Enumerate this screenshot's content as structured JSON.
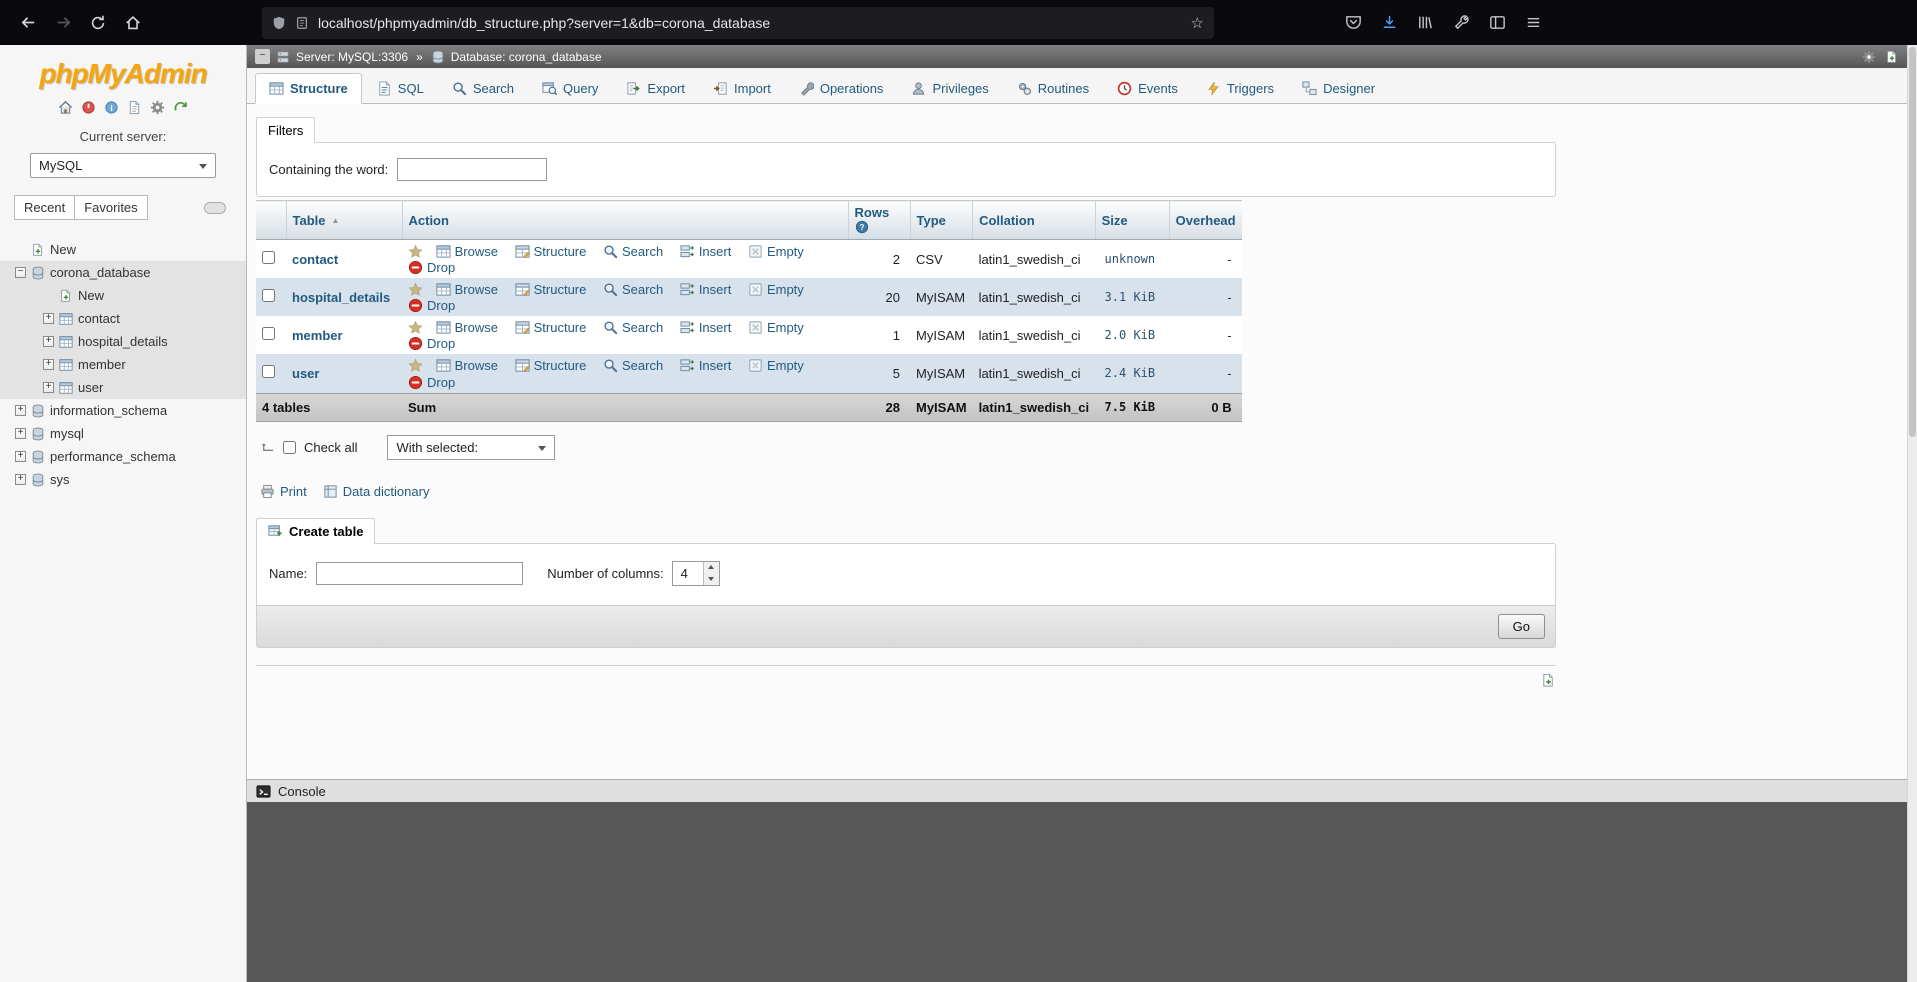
{
  "browser": {
    "url": "localhost/phpmyadmin/db_structure.php?server=1&db=corona_database"
  },
  "sidebar": {
    "logo": "phpMyAdmin",
    "current_server_label": "Current server:",
    "server_select": "MySQL",
    "recent_label": "Recent",
    "favorites_label": "Favorites",
    "tree": {
      "new_top": "New",
      "database": "corona_database",
      "new_sub": "New",
      "tables": [
        "contact",
        "hospital_details",
        "member",
        "user"
      ],
      "others": [
        "information_schema",
        "mysql",
        "performance_schema",
        "sys"
      ]
    }
  },
  "serverbar": {
    "server": "Server: MySQL:3306",
    "sep": "»",
    "database": "Database: corona_database"
  },
  "tabs": [
    {
      "label": "Structure",
      "icon": "structure-table-icon"
    },
    {
      "label": "SQL",
      "icon": "sql-file-icon"
    },
    {
      "label": "Search",
      "icon": "search-icon"
    },
    {
      "label": "Query",
      "icon": "query-icon"
    },
    {
      "label": "Export",
      "icon": "export-icon"
    },
    {
      "label": "Import",
      "icon": "import-icon"
    },
    {
      "label": "Operations",
      "icon": "operations-wrench-icon"
    },
    {
      "label": "Privileges",
      "icon": "privileges-user-icon"
    },
    {
      "label": "Routines",
      "icon": "routines-gears-icon"
    },
    {
      "label": "Events",
      "icon": "events-clock-icon"
    },
    {
      "label": "Triggers",
      "icon": "triggers-bolt-icon"
    },
    {
      "label": "Designer",
      "icon": "designer-icon"
    }
  ],
  "filters": {
    "legend": "Filters",
    "containing_label": "Containing the word:"
  },
  "tables_list": {
    "headers": {
      "table": "Table",
      "action": "Action",
      "rows": "Rows",
      "type": "Type",
      "collation": "Collation",
      "size": "Size",
      "overhead": "Overhead"
    },
    "actions": {
      "browse": "Browse",
      "structure": "Structure",
      "search": "Search",
      "insert": "Insert",
      "empty": "Empty",
      "drop": "Drop"
    },
    "rows": [
      {
        "name": "contact",
        "rows": "2",
        "type": "CSV",
        "collation": "latin1_swedish_ci",
        "size": "unknown",
        "overhead": "-"
      },
      {
        "name": "hospital_details",
        "rows": "20",
        "type": "MyISAM",
        "collation": "latin1_swedish_ci",
        "size": "3.1 KiB",
        "overhead": "-"
      },
      {
        "name": "member",
        "rows": "1",
        "type": "MyISAM",
        "collation": "latin1_swedish_ci",
        "size": "2.0 KiB",
        "overhead": "-"
      },
      {
        "name": "user",
        "rows": "5",
        "type": "MyISAM",
        "collation": "latin1_swedish_ci",
        "size": "2.4 KiB",
        "overhead": "-"
      }
    ],
    "sum": {
      "count": "4 tables",
      "label": "Sum",
      "rows": "28",
      "type": "MyISAM",
      "collation": "latin1_swedish_ci",
      "size": "7.5 KiB",
      "overhead": "0 B"
    }
  },
  "bulk": {
    "check_all": "Check all",
    "with_selected": "With selected:"
  },
  "actions_bar": {
    "print": "Print",
    "data_dictionary": "Data dictionary"
  },
  "create_table": {
    "legend": "Create table",
    "name_label": "Name:",
    "columns_label": "Number of columns:",
    "columns_value": "4",
    "go_label": "Go"
  },
  "console": {
    "label": "Console"
  },
  "colors": {
    "accent_link": "#235a81",
    "logo_orange": "#f7a50d",
    "row_stripe": "#d7e2ec",
    "drop_red": "#d83025"
  },
  "icon_names": [
    "back-icon",
    "forward-icon",
    "reload-icon",
    "home-icon",
    "shield-icon",
    "page-info-icon",
    "bookmark-star-icon",
    "pocket-icon",
    "download-icon",
    "library-icon",
    "wrench-icon",
    "sidebar-panel-icon",
    "menu-icon",
    "pma-home-icon",
    "logout-icon",
    "info-icon",
    "docs-icon",
    "settings-gear-icon",
    "refresh-icon",
    "plus-box-icon",
    "minus-box-icon",
    "database-icon",
    "table-icon",
    "new-item-icon",
    "server-icon",
    "favorite-star-icon",
    "browse-icon",
    "structure-icon",
    "search-icon",
    "insert-icon",
    "empty-icon",
    "drop-icon",
    "help-icon",
    "sort-asc-icon",
    "return-arrow-icon",
    "printer-icon",
    "data-dictionary-icon",
    "create-table-icon",
    "spinner-up-icon",
    "spinner-down-icon",
    "console-icon",
    "new-window-icon"
  ]
}
